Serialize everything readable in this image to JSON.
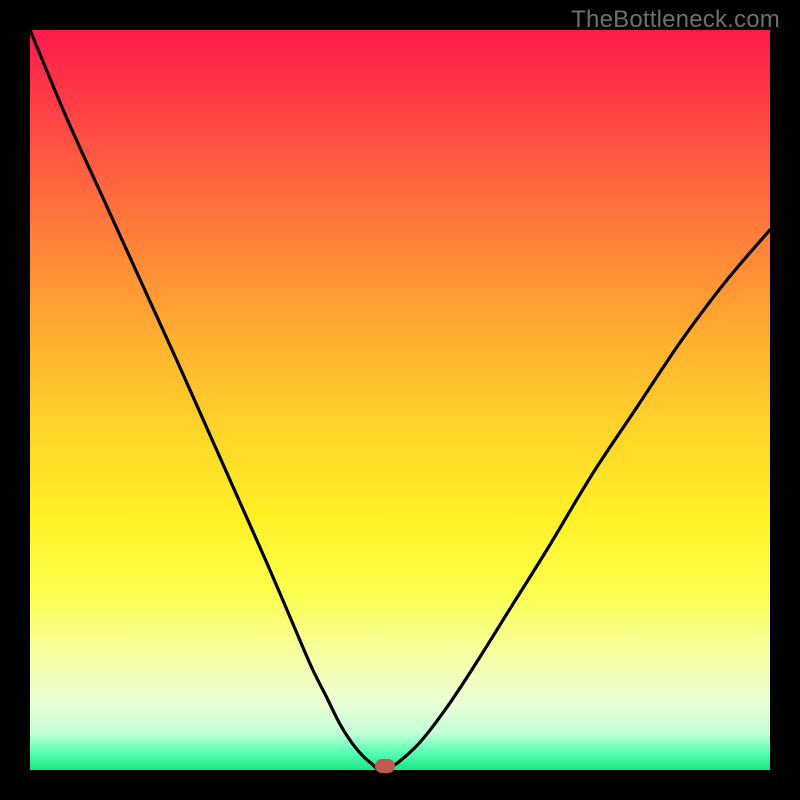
{
  "watermark": "TheBottleneck.com",
  "colors": {
    "frame": "#000000",
    "watermark": "#6f6f6f",
    "curve": "#000000",
    "marker": "#c05a55",
    "gradient_top": "#ff1a4b",
    "gradient_bottom": "#17e884"
  },
  "chart_data": {
    "type": "line",
    "title": "",
    "xlabel": "",
    "ylabel": "",
    "xlim": [
      0,
      100
    ],
    "ylim": [
      0,
      100
    ],
    "grid": false,
    "legend": false,
    "series": [
      {
        "name": "bottleneck-curve",
        "x": [
          0,
          5,
          10,
          15,
          20,
          24,
          28,
          32,
          35,
          38,
          40,
          42,
          44,
          46,
          48,
          52,
          56,
          60,
          65,
          70,
          76,
          82,
          88,
          94,
          100
        ],
        "y": [
          100,
          88,
          77,
          66,
          55,
          46,
          37,
          28,
          21,
          14,
          10,
          6,
          3,
          1,
          0,
          3,
          8,
          14,
          22,
          30,
          40,
          49,
          58,
          66,
          73
        ]
      }
    ],
    "annotations": [
      {
        "name": "minimum-marker",
        "x": 48,
        "y": 0
      }
    ],
    "background_gradient": {
      "orientation": "vertical",
      "stops": [
        {
          "pos": 0.0,
          "color": "#ff1a4b"
        },
        {
          "pos": 0.5,
          "color": "#ffd42a"
        },
        {
          "pos": 0.85,
          "color": "#f6ffa8"
        },
        {
          "pos": 1.0,
          "color": "#17e884"
        }
      ]
    }
  }
}
